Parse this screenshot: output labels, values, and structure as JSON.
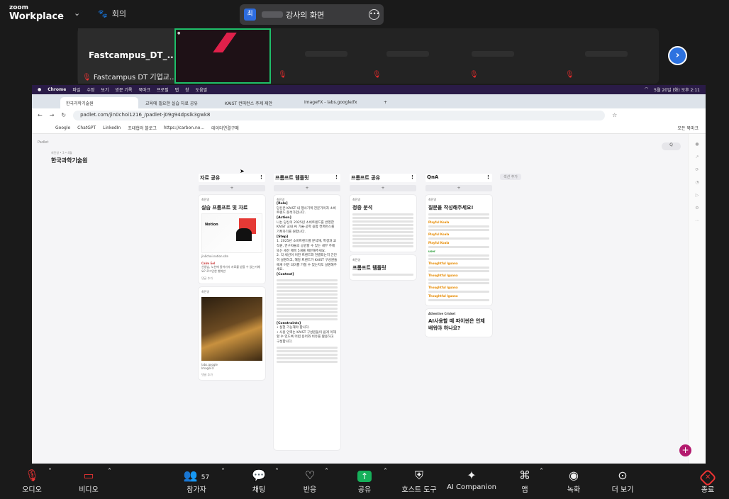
{
  "zoom": {
    "logo_small": "zoom",
    "logo_big": "Workplace",
    "meeting_label": "회의",
    "share_badge": "최",
    "share_text": "강사의 화면",
    "tile_name": "Fastcampus_DT_...",
    "tile_sub": "Fastcampus DT 기업교..."
  },
  "browser": {
    "mac_menu": [
      "Chrome",
      "파일",
      "수정",
      "보기",
      "방문 기록",
      "북마크",
      "프로필",
      "탭",
      "창",
      "도움말"
    ],
    "mac_clock": "5월 20일 (화) 오후 2:11",
    "tabs": [
      "한국과학기술원",
      "교육에 필요한 실습 자료 공유",
      "KAIST 컨퍼런스 주제 제안",
      "ImageFX - labs.google/fx"
    ],
    "url": "padlet.com/jin0choi1216_/padlet-j09g94dpslk3gwk8",
    "bookmarks": [
      "Google",
      "ChatGPT",
      "LinkedIn",
      "조대협의 블로그",
      "https://carbon.no...",
      "데이터연결구매"
    ],
    "bookmarks_right": "모든 북마크"
  },
  "padlet": {
    "brand": "Padlet",
    "crumb": "최진영 • 3 • 4월",
    "title": "한국과학기술원",
    "search": "Q",
    "add_column": "섹션 추가",
    "columns": [
      {
        "title": "자료 공유",
        "add": "+"
      },
      {
        "title": "프롬프트 템플릿",
        "add": "+"
      },
      {
        "title": "프롬프트 공유",
        "add": "+"
      },
      {
        "title": "QnA",
        "add": "+"
      }
    ],
    "c1": {
      "who": "최진영",
      "t1": "실습 프롬프트 및 자료",
      "notion": "Notion",
      "site": "jin0choi.notion.site",
      "cm": "Calm Eel",
      "cm_text": "선생님, 노션에 들어가서 자료를 받을 수 있는거예요? 로그인한 했지만",
      "link": "labs.google",
      "link2": "ImageFX",
      "foot": "댓글 추가"
    },
    "c2": {
      "who": "최진영",
      "role_h": "[Role]",
      "role": "당신은 KAIST 내 행사기획 전문가이자 소비 트렌드 분석가입니다.",
      "action_h": "[Action]",
      "action": "나는 당신이 2025년 소비트렌드를 반영한 KAIST 교내 AI 기술·공학 융합 컨퍼런스를 기획하기를 원합니다.",
      "step_h": "[Step]",
      "s1": "2025년 소비트렌드를 분석해, 학생과 교직원, 연구자들의 공감할 수 있는 세부 주제 또는 세션 제목 5개를 제안해주세요.",
      "s2": "각 세션이 어떤 트렌드와 연결되는지 간단히 설명하고, 해당 트렌드가 KAIST 구성원들에게 어떤 의미를 가질 수 있는지도 설명해주세요.",
      "ctx_h": "[Context]",
      "cst_h": "[Constraints]",
      "k1": "실현 가능해야 합니다.",
      "k2": "사용 인력는 KAIST 구성원들이 쉽게 이해할 수 있도록 어렵 용어와 비유를 활용하고 구성합니다."
    },
    "c3": {
      "who": "최진영",
      "t1": "청중 분석",
      "t2": "프롬프트 템플릿"
    },
    "c4": {
      "who": "최진영",
      "t1": "질문을 작성해주세요!",
      "users": [
        "Playful Koala",
        "Playful Koala",
        "Playful Koala",
        "user",
        "Thoughtful Iguana",
        "Thoughtful Iguana",
        "Thoughtful Iguana",
        "Thoughtful Iguana"
      ],
      "ac": "Attentive Cricket",
      "ac_q": "AI사용할 때 파이썬은 언제 배워야 하나요?"
    }
  },
  "toolbar": {
    "audio": "오디오",
    "video": "비디오",
    "participants": "참가자",
    "participants_count": "57",
    "chat": "채팅",
    "reactions": "반응",
    "share": "공유",
    "host": "호스트 도구",
    "ai": "AI Companion",
    "apps": "앱",
    "record": "녹화",
    "more": "더 보기",
    "end": "종료"
  }
}
